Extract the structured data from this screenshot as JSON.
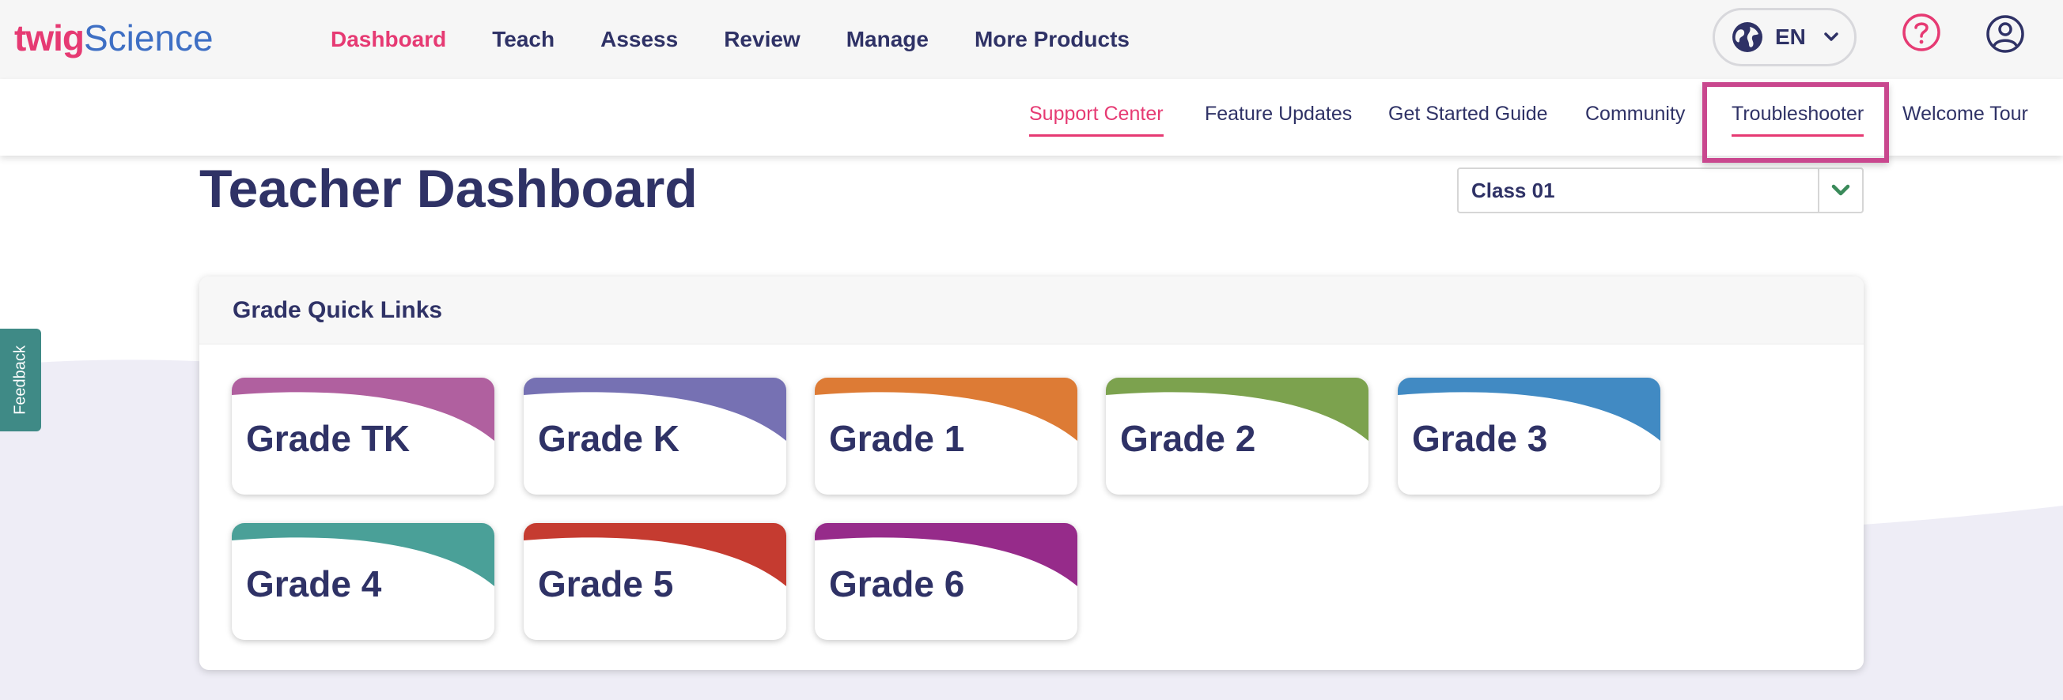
{
  "header": {
    "logo": {
      "twig": "twig",
      "science": "Science"
    },
    "nav": [
      "Dashboard",
      "Teach",
      "Assess",
      "Review",
      "Manage",
      "More Products"
    ],
    "active_nav": "Dashboard",
    "language": {
      "code": "EN",
      "icon": "globe-icon"
    },
    "help_icon": "question-circle-icon",
    "user_icon": "user-circle-icon"
  },
  "subnav": {
    "items": [
      "Support Center",
      "Feature Updates",
      "Get Started Guide",
      "Community",
      "Troubleshooter",
      "Welcome Tour"
    ],
    "active": "Support Center",
    "highlighted": "Troubleshooter"
  },
  "page": {
    "title": "Teacher Dashboard",
    "class_select": {
      "value": "Class 01",
      "icon": "chevron-down-icon"
    }
  },
  "quick_links": {
    "title": "Grade Quick Links",
    "grades": [
      {
        "label": "Grade TK",
        "color": "#b0609f"
      },
      {
        "label": "Grade K",
        "color": "#7671b3"
      },
      {
        "label": "Grade 1",
        "color": "#dd7b35"
      },
      {
        "label": "Grade 2",
        "color": "#7ca24e"
      },
      {
        "label": "Grade 3",
        "color": "#418ac3"
      },
      {
        "label": "Grade 4",
        "color": "#4aa098"
      },
      {
        "label": "Grade 5",
        "color": "#c53b30"
      },
      {
        "label": "Grade 6",
        "color": "#962b8a"
      }
    ]
  },
  "feedback": {
    "label": "Feedback"
  },
  "colors": {
    "brand_pink": "#e63a73",
    "brand_blue": "#3e6fc4",
    "navy": "#2f3266",
    "feedback_teal": "#3f8a86",
    "highlight": "#c9478e"
  }
}
